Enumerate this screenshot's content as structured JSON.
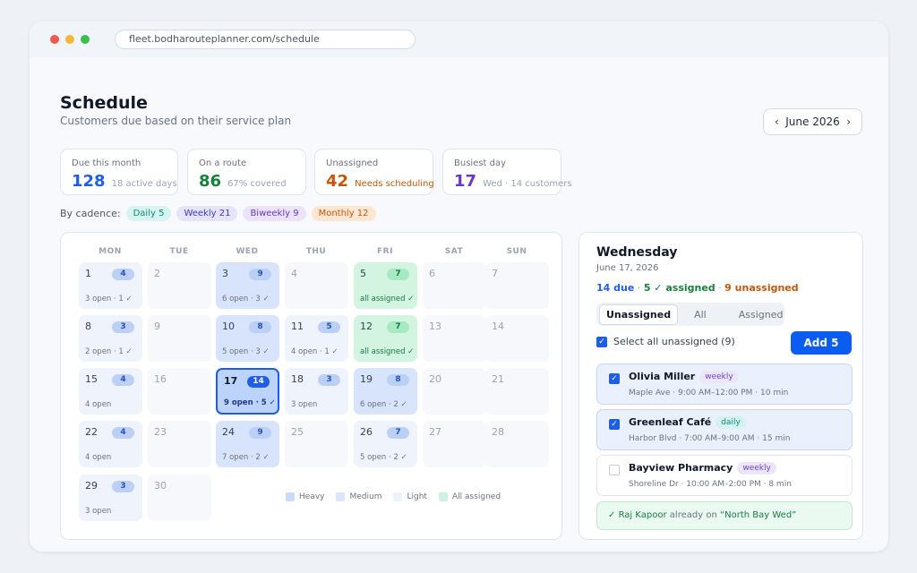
{
  "browser": {
    "url": "fleet.bodharouteplanner.com/schedule"
  },
  "header": {
    "title": "Schedule",
    "subtitle": "Customers due based on their service plan",
    "month": "June 2026",
    "prev_icon": "‹",
    "next_icon": "›"
  },
  "stats": [
    {
      "label": "Due this month",
      "value": "128",
      "note": "18 active days",
      "color": "#1e5ee5"
    },
    {
      "label": "On a route",
      "value": "86",
      "note": "67% covered",
      "color": "#17803d"
    },
    {
      "label": "Unassigned",
      "value": "42",
      "note": "Needs scheduling",
      "color": "#c2570c"
    },
    {
      "label": "Busiest day",
      "value": "17",
      "note": "Wed · 14 customers",
      "color": "#6b36c9"
    }
  ],
  "cadence": {
    "label": "By cadence:",
    "chips": [
      {
        "label": "Daily 5",
        "bg": "#d7f4f1",
        "fg": "#0f8a7a"
      },
      {
        "label": "Weekly 21",
        "bg": "#e5e4fb",
        "fg": "#4338ca"
      },
      {
        "label": "Biweekly 9",
        "bg": "#ebe3f8",
        "fg": "#6b36c9"
      },
      {
        "label": "Monthly 12",
        "bg": "#fde7d2",
        "fg": "#c2570c"
      }
    ]
  },
  "calendar": {
    "weekdays": [
      "MON",
      "TUE",
      "WED",
      "THU",
      "FRI",
      "SAT",
      "SUN"
    ],
    "days": [
      {
        "n": "1",
        "count": "4",
        "info": "3 open · 1 ✓",
        "kind": "light"
      },
      {
        "n": "2",
        "count": "",
        "info": "",
        "kind": "empty"
      },
      {
        "n": "3",
        "count": "9",
        "info": "6 open · 3 ✓",
        "kind": "heavy"
      },
      {
        "n": "4",
        "count": "",
        "info": "",
        "kind": "empty"
      },
      {
        "n": "5",
        "count": "7",
        "info": "all assigned ✓",
        "kind": "done"
      },
      {
        "n": "6",
        "count": "",
        "info": "",
        "kind": "empty"
      },
      {
        "n": "7",
        "count": "",
        "info": "",
        "kind": "empty"
      },
      {
        "n": "8",
        "count": "3",
        "info": "2 open · 1 ✓",
        "kind": "light"
      },
      {
        "n": "9",
        "count": "",
        "info": "",
        "kind": "empty"
      },
      {
        "n": "10",
        "count": "8",
        "info": "5 open · 3 ✓",
        "kind": "heavy"
      },
      {
        "n": "11",
        "count": "5",
        "info": "4 open · 1 ✓",
        "kind": "light"
      },
      {
        "n": "12",
        "count": "7",
        "info": "all assigned ✓",
        "kind": "done"
      },
      {
        "n": "13",
        "count": "",
        "info": "",
        "kind": "empty"
      },
      {
        "n": "14",
        "count": "",
        "info": "",
        "kind": "empty"
      },
      {
        "n": "15",
        "count": "4",
        "info": "4 open",
        "kind": "light"
      },
      {
        "n": "16",
        "count": "",
        "info": "",
        "kind": "empty"
      },
      {
        "n": "17",
        "count": "14",
        "info": "9 open · 5 ✓",
        "kind": "sel"
      },
      {
        "n": "18",
        "count": "3",
        "info": "3 open",
        "kind": "light"
      },
      {
        "n": "19",
        "count": "8",
        "info": "6 open · 2 ✓",
        "kind": "heavy"
      },
      {
        "n": "20",
        "count": "",
        "info": "",
        "kind": "empty"
      },
      {
        "n": "21",
        "count": "",
        "info": "",
        "kind": "empty"
      },
      {
        "n": "22",
        "count": "4",
        "info": "4 open",
        "kind": "light"
      },
      {
        "n": "23",
        "count": "",
        "info": "",
        "kind": "empty"
      },
      {
        "n": "24",
        "count": "9",
        "info": "7 open · 2 ✓",
        "kind": "heavy"
      },
      {
        "n": "25",
        "count": "",
        "info": "",
        "kind": "empty"
      },
      {
        "n": "26",
        "count": "7",
        "info": "5 open · 2 ✓",
        "kind": "light"
      },
      {
        "n": "27",
        "count": "",
        "info": "",
        "kind": "empty"
      },
      {
        "n": "28",
        "count": "",
        "info": "",
        "kind": "empty"
      },
      {
        "n": "29",
        "count": "3",
        "info": "3 open",
        "kind": "light"
      },
      {
        "n": "30",
        "count": "",
        "info": "",
        "kind": "empty"
      }
    ],
    "legend": [
      {
        "label": "Heavy",
        "color": "#c8dbf8"
      },
      {
        "label": "Medium",
        "color": "#dbe6fa"
      },
      {
        "label": "Light",
        "color": "#eef2fb"
      },
      {
        "label": "All assigned",
        "color": "#cdf2dd"
      }
    ]
  },
  "panel": {
    "title": "Wednesday",
    "date": "June 17, 2026",
    "summary": {
      "due": "14 due",
      "assigned": "5 ✓ assigned",
      "unassigned": "9 unassigned",
      "sep": " · "
    },
    "tabs": [
      "Unassigned",
      "All",
      "Assigned"
    ],
    "select_all": "Select all unassigned (9)",
    "add_button": "Add 5",
    "customers": [
      {
        "name": "Olivia Miller",
        "tag": "weekly",
        "details": "Maple Ave · 9:00 AM–12:00 PM · 10 min",
        "checked": true
      },
      {
        "name": "Greenleaf Café",
        "tag": "daily",
        "details": "Harbor Blvd · 7:00 AM–9:00 AM · 15 min",
        "checked": true
      },
      {
        "name": "Bayview Pharmacy",
        "tag": "weekly",
        "details": "Shoreline Dr · 10:00 AM–2:00 PM · 8 min",
        "checked": false
      }
    ],
    "notice": {
      "check": "✓",
      "name": "Raj Kapoor",
      "middle": "already on",
      "route": "“North Bay Wed”"
    }
  }
}
